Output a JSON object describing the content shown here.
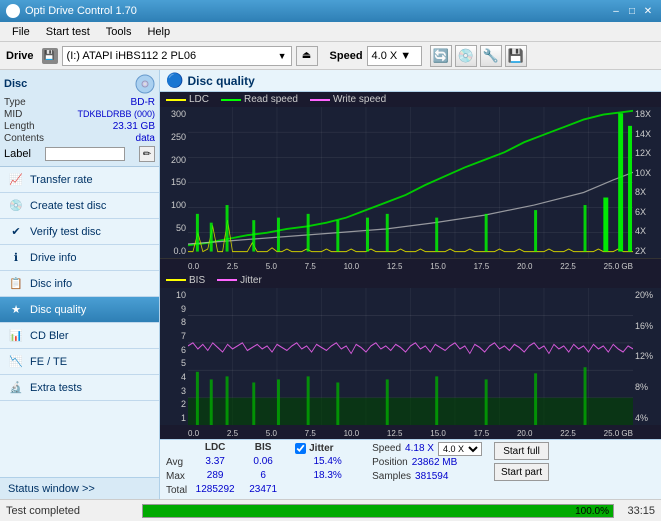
{
  "titleBar": {
    "title": "Opti Drive Control 1.70",
    "minBtn": "–",
    "maxBtn": "□",
    "closeBtn": "✕"
  },
  "menuBar": {
    "items": [
      "File",
      "Start test",
      "Tools",
      "Help"
    ]
  },
  "driveBar": {
    "label": "Drive",
    "driveValue": "(I:)  ATAPI iHBS112  2 PL06",
    "speedLabel": "Speed",
    "speedValue": "4.0 X  ▼",
    "ejectSymbol": "⏏"
  },
  "disc": {
    "sectionLabel": "Disc",
    "typeLabel": "Type",
    "typeValue": "BD-R",
    "midLabel": "MID",
    "midValue": "TDKBLDRBB (000)",
    "lengthLabel": "Length",
    "lengthValue": "23.31 GB",
    "contentsLabel": "Contents",
    "contentsValue": "data",
    "labelLabel": "Label",
    "labelValue": ""
  },
  "navItems": [
    {
      "id": "transfer-rate",
      "label": "Transfer rate",
      "icon": "📈"
    },
    {
      "id": "create-test-disc",
      "label": "Create test disc",
      "icon": "💿"
    },
    {
      "id": "verify-test-disc",
      "label": "Verify test disc",
      "icon": "✔"
    },
    {
      "id": "drive-info",
      "label": "Drive info",
      "icon": "ℹ"
    },
    {
      "id": "disc-info",
      "label": "Disc info",
      "icon": "📋"
    },
    {
      "id": "disc-quality",
      "label": "Disc quality",
      "icon": "★",
      "active": true
    },
    {
      "id": "cd-bler",
      "label": "CD Bler",
      "icon": "📊"
    },
    {
      "id": "fe-te",
      "label": "FE / TE",
      "icon": "📉"
    },
    {
      "id": "extra-tests",
      "label": "Extra tests",
      "icon": "🔬"
    }
  ],
  "statusWindowBtn": "Status window >>",
  "chartHeader": {
    "icon": "🔵",
    "title": "Disc quality"
  },
  "upperChart": {
    "legendItems": [
      {
        "color": "#ffff00",
        "label": "LDC"
      },
      {
        "color": "#00ff00",
        "label": "Read speed"
      },
      {
        "color": "#ff66ff",
        "label": "Write speed"
      }
    ],
    "yAxisLeft": [
      "300",
      "250",
      "200",
      "150",
      "100",
      "50",
      "0.0"
    ],
    "yAxisRight": [
      "18X",
      "14X",
      "12X",
      "10X",
      "8X",
      "6X",
      "4X",
      "2X"
    ],
    "xAxis": [
      "0.0",
      "2.5",
      "5.0",
      "7.5",
      "10.0",
      "12.5",
      "15.0",
      "17.5",
      "20.0",
      "22.5",
      "25.0 GB"
    ]
  },
  "lowerChart": {
    "legendItems": [
      {
        "color": "#ffff00",
        "label": "BIS"
      },
      {
        "color": "#ff66ff",
        "label": "Jitter"
      }
    ],
    "yAxisLeft": [
      "10",
      "9",
      "8",
      "7",
      "6",
      "5",
      "4",
      "3",
      "2",
      "1"
    ],
    "yAxisRight": [
      "20%",
      "16%",
      "12%",
      "8%",
      "4%"
    ],
    "xAxis": [
      "0.0",
      "2.5",
      "5.0",
      "7.5",
      "10.0",
      "12.5",
      "15.0",
      "17.5",
      "20.0",
      "22.5",
      "25.0 GB"
    ]
  },
  "stats": {
    "avgLabel": "Avg",
    "maxLabel": "Max",
    "totalLabel": "Total",
    "ldcHeader": "LDC",
    "bisHeader": "BIS",
    "ldcAvg": "3.37",
    "ldcMax": "289",
    "ldcTotal": "1285292",
    "bisAvg": "0.06",
    "bisMax": "6",
    "bisTotal": "23471",
    "jitterLabel": "Jitter",
    "jitterAvg": "15.4%",
    "jitterMax": "18.3%",
    "jitterTotal": "",
    "speedLabel": "Speed",
    "speedValue": "4.18 X",
    "speedDropdown": "4.0 X  ▼",
    "positionLabel": "Position",
    "positionValue": "23862 MB",
    "samplesLabel": "Samples",
    "samplesValue": "381594",
    "startFullBtn": "Start full",
    "startPartBtn": "Start part"
  },
  "statusBar": {
    "text": "Test completed",
    "progressPercent": 100,
    "progressLabel": "100.0%",
    "time": "33:15"
  }
}
